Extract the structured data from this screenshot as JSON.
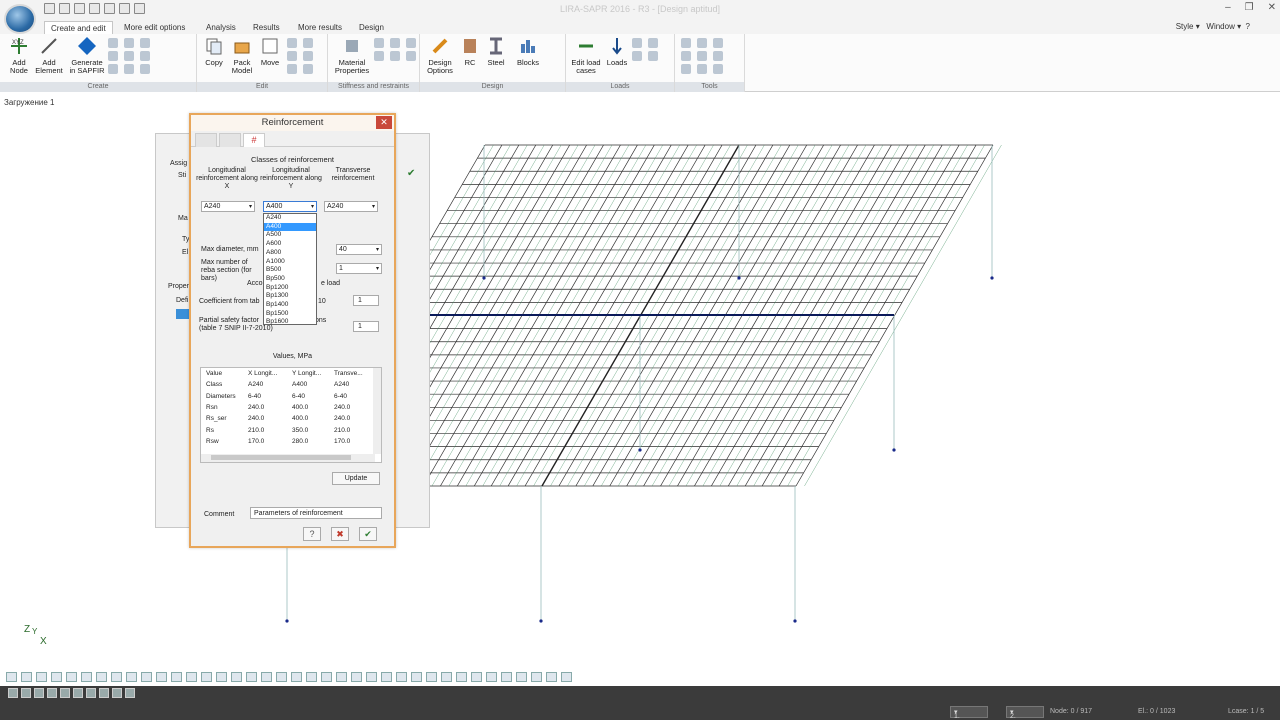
{
  "window": {
    "title": "LIRA-SAPR 2016 - R3 - [Design aptitud]"
  },
  "tabs": [
    "Create and edit",
    "More edit options",
    "Analysis",
    "Results",
    "More results",
    "Design"
  ],
  "tabs_right": [
    "Style",
    "Window"
  ],
  "ribbon": {
    "groups": [
      {
        "label": "Create",
        "buttons": [
          "Add Node",
          "Add Element",
          "Generate in SAPFIR"
        ]
      },
      {
        "label": "Edit",
        "buttons": [
          "Copy",
          "Pack Model",
          "Move"
        ]
      },
      {
        "label": "Stiffness and restraints",
        "buttons": [
          "Material Properties"
        ]
      },
      {
        "label": "Design",
        "buttons": [
          "Design Options",
          "RC",
          "Steel",
          "Blocks"
        ]
      },
      {
        "label": "Loads",
        "buttons": [
          "Edit load cases",
          "Loads"
        ]
      },
      {
        "label": "Tools",
        "buttons": []
      }
    ]
  },
  "loadcase_label": "Загружение 1",
  "dialog": {
    "title": "Reinforcement",
    "classes_title": "Classes of reinforcement",
    "col_headers": [
      "Longitudinal reinforcement along X",
      "Longitudinal reinforcement along Y",
      "Transverse reinforcement"
    ],
    "combo_values": [
      "A240",
      "A400",
      "A240"
    ],
    "dropdown_options": [
      "A240",
      "A400",
      "A500",
      "A600",
      "A800",
      "A1000",
      "B500",
      "Bp500",
      "Bp1200",
      "Bp1300",
      "Bp1400",
      "Bp1500",
      "Bp1600"
    ],
    "dropdown_selected": "A400",
    "max_diameter_label": "Max diameter, mm",
    "max_diameter_value": "40",
    "max_bars_label": "Max number of reba section (for bars)",
    "max_bars_value": "1",
    "acc_label": "Acco",
    "load_label": "e load",
    "coef_label": "Coefficient from tab",
    "coef_suffix": "10",
    "coef_value": "1",
    "psf_label": "Partial safety factor",
    "psf_suffix": "ons",
    "psf_note": "(table 7 SNIP II-7-2010)",
    "psf_value": "1",
    "values_title": "Values, MPa",
    "values_table": {
      "headers": [
        "Value",
        "X Longit...",
        "Y Longit...",
        "Transve..."
      ],
      "rows": [
        [
          "Class",
          "A240",
          "A400",
          "A240"
        ],
        [
          "Diameters",
          "6-40",
          "6-40",
          "6-40"
        ],
        [
          "Rsn",
          "240.0",
          "400.0",
          "240.0"
        ],
        [
          "Rs_ser",
          "240.0",
          "400.0",
          "240.0"
        ],
        [
          "Rs",
          "210.0",
          "350.0",
          "210.0"
        ],
        [
          "Rsw",
          "170.0",
          "280.0",
          "170.0"
        ]
      ]
    },
    "update_label": "Update",
    "comment_label": "Comment",
    "comment_value": "Parameters of reinforcement",
    "footer_buttons": [
      "?",
      "✖",
      "✔"
    ]
  },
  "background_dialog": {
    "fragments": [
      "Assig",
      "Sti",
      "Ma",
      "Ty",
      "El",
      "Proper",
      "Defi"
    ]
  },
  "axis": {
    "z": "Z",
    "y": "Y",
    "x": "X"
  },
  "status": {
    "page_value": "1.",
    "zoom_value": "2.",
    "node": "Node: 0 / 917",
    "elements": "El.: 0 / 1023",
    "loadcase": "Lcase: 1 / 5"
  },
  "colors": {
    "dialog_border": "#e8a65a",
    "mesh": "#2e2e2e",
    "mesh_accent": "#3a8a5a",
    "close_red": "#c9483a"
  }
}
